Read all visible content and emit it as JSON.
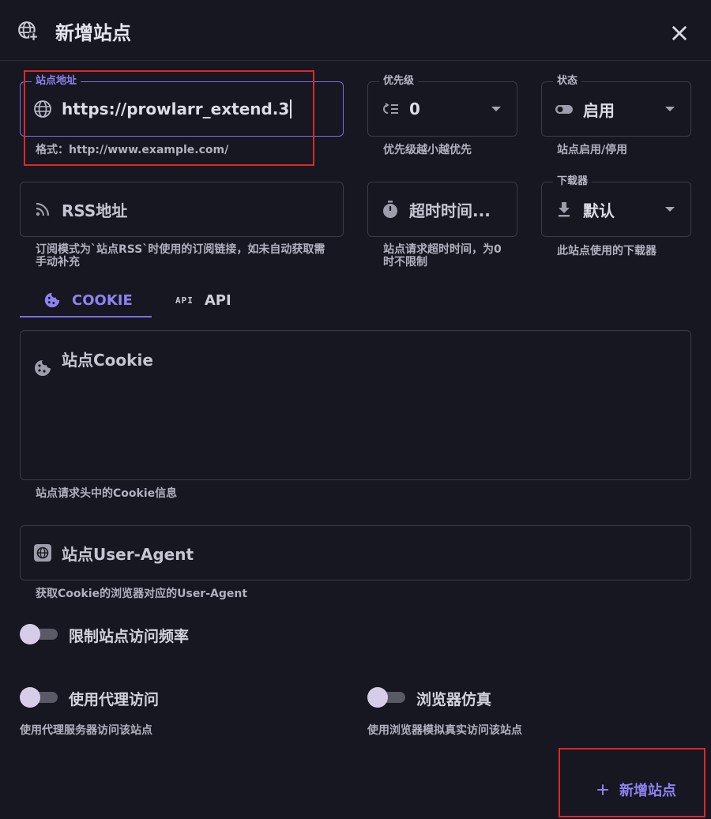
{
  "dialog": {
    "title": "新增站点"
  },
  "fields": {
    "url": {
      "label": "站点地址",
      "value": "https://prowlarr_extend.3",
      "hint": "格式：http://www.example.com/",
      "icon": "globe-icon"
    },
    "priority": {
      "label": "优先级",
      "value": "0",
      "hint": "优先级越小越优先",
      "icon": "priority-list-icon"
    },
    "status": {
      "label": "状态",
      "value": "启用",
      "hint": "站点启用/停用",
      "icon": "toggle-icon"
    },
    "rss": {
      "placeholder": "RSS地址",
      "hint": "订阅模式为`站点RSS`时使用的订阅链接，如未自动获取需手动补充",
      "icon": "rss-icon"
    },
    "timeout": {
      "placeholder": "超时时间...",
      "hint": "站点请求超时时间，为0时不限制",
      "icon": "timer-icon"
    },
    "downloader": {
      "label": "下载器",
      "value": "默认",
      "hint": "此站点使用的下载器",
      "icon": "download-icon"
    }
  },
  "tabs": [
    {
      "label": "COOKIE",
      "icon": "cookie-icon",
      "active": true
    },
    {
      "label": "API",
      "icon_text": "API",
      "active": false
    }
  ],
  "cookie_field": {
    "placeholder": "站点Cookie",
    "hint": "站点请求头中的Cookie信息",
    "icon": "cookie-icon"
  },
  "ua_field": {
    "placeholder": "站点User-Agent",
    "hint": "获取Cookie的浏览器对应的User-Agent",
    "icon": "browser-icon"
  },
  "toggles": {
    "limit": {
      "label": "限制站点访问频率",
      "on": false
    },
    "proxy": {
      "label": "使用代理访问",
      "hint": "使用代理服务器访问该站点",
      "on": false
    },
    "browser": {
      "label": "浏览器仿真",
      "hint": "使用浏览器模拟真实访问该站点",
      "on": false
    }
  },
  "actions": {
    "add_label": "新增站点"
  },
  "colors": {
    "background": "#161720",
    "accent": "#7b6fe0",
    "annotation": "#e0262a"
  }
}
